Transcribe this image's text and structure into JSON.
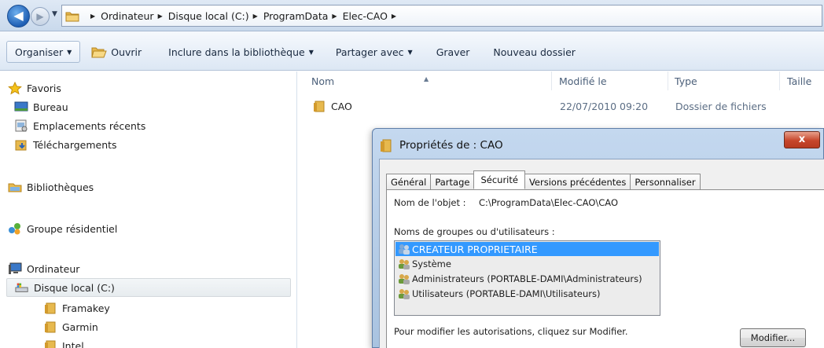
{
  "breadcrumb": [
    "Ordinateur",
    "Disque local (C:)",
    "ProgramData",
    "Elec-CAO"
  ],
  "toolbar": {
    "organize": "Organiser",
    "open": "Ouvrir",
    "include": "Inclure dans la bibliothèque",
    "share": "Partager avec",
    "burn": "Graver",
    "new_folder": "Nouveau dossier"
  },
  "nav": {
    "favorites": "Favoris",
    "desktop": "Bureau",
    "recent": "Emplacements récents",
    "downloads": "Téléchargements",
    "libraries": "Bibliothèques",
    "homegroup": "Groupe résidentiel",
    "computer": "Ordinateur",
    "local_disk": "Disque local (C:)",
    "folders": [
      "Framakey",
      "Garmin",
      "Intel"
    ]
  },
  "columns": {
    "name": "Nom",
    "modified": "Modifié le",
    "type": "Type",
    "size": "Taille"
  },
  "files": [
    {
      "name": "CAO",
      "modified": "22/07/2010 09:20",
      "type": "Dossier de fichiers"
    }
  ],
  "dialog": {
    "title": "Propriétés de : CAO",
    "close": "x",
    "tabs": [
      "Général",
      "Partage",
      "Sécurité",
      "Versions précédentes",
      "Personnaliser"
    ],
    "active_tab": "Sécurité",
    "object_label": "Nom de l'objet :",
    "object_value": "C:\\ProgramData\\Elec-CAO\\CAO",
    "groups_label": "Noms de groupes ou d'utilisateurs :",
    "groups": [
      "CREATEUR PROPRIETAIRE",
      "Système",
      "Administrateurs (PORTABLE-DAMI\\Administrateurs)",
      "Utilisateurs (PORTABLE-DAMI\\Utilisateurs)"
    ],
    "modify_text": "Pour modifier les autorisations, cliquez sur Modifier.",
    "modify_button": "Modifier..."
  },
  "colors": {
    "selection": "#3399ff",
    "folder": "#e7b94e",
    "accent": "#1f5fb4"
  }
}
